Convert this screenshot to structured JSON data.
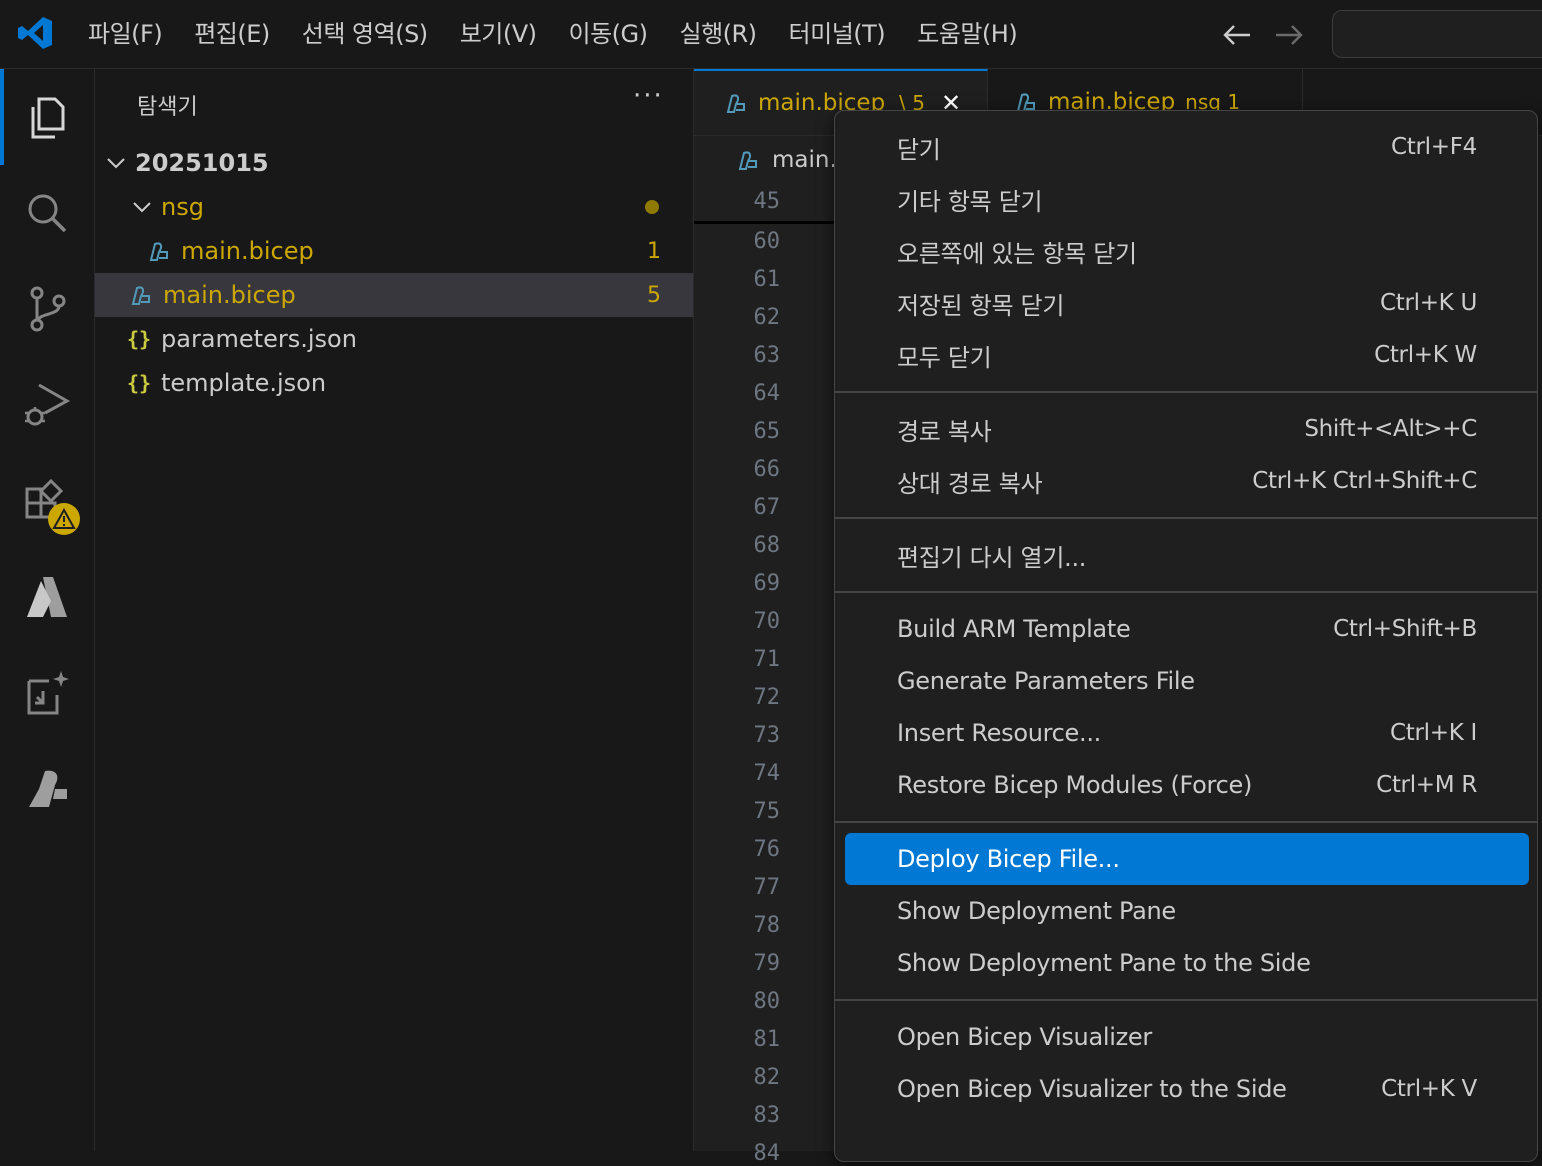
{
  "menubar": {
    "items": [
      "파일(F)",
      "편집(E)",
      "선택 영역(S)",
      "보기(V)",
      "이동(G)",
      "실행(R)",
      "터미널(T)",
      "도움말(H)"
    ]
  },
  "sidebar": {
    "title": "탐색기",
    "more": "···",
    "tree": {
      "root": "20251015",
      "folder": "nsg",
      "nsg_file": "main.bicep",
      "nsg_file_count": "1",
      "main_file": "main.bicep",
      "main_file_count": "5",
      "params_file": "parameters.json",
      "template_file": "template.json",
      "braces": "{}"
    }
  },
  "editor": {
    "tabs": [
      {
        "label": "main.bicep",
        "suffix": "\\ 5",
        "close": "✕"
      },
      {
        "label": "main.bicep",
        "suffix": "nsg 1"
      }
    ],
    "breadcrumb": "main.",
    "sticky_line": "45",
    "line_numbers": [
      "60",
      "61",
      "62",
      "63",
      "64",
      "65",
      "66",
      "67",
      "68",
      "69",
      "70",
      "71",
      "72",
      "73",
      "74",
      "75",
      "76",
      "77",
      "78",
      "79",
      "80",
      "81",
      "82",
      "83",
      "84"
    ]
  },
  "context_menu": {
    "groups": [
      [
        {
          "label": "닫기",
          "key": "Ctrl+F4"
        },
        {
          "label": "기타 항목 닫기",
          "key": ""
        },
        {
          "label": "오른쪽에 있는 항목 닫기",
          "key": ""
        },
        {
          "label": "저장된 항목 닫기",
          "key": "Ctrl+K U"
        },
        {
          "label": "모두 닫기",
          "key": "Ctrl+K W"
        }
      ],
      [
        {
          "label": "경로 복사",
          "key": "Shift+<Alt>+C"
        },
        {
          "label": "상대 경로 복사",
          "key": "Ctrl+K Ctrl+Shift+C"
        }
      ],
      [
        {
          "label": "편집기 다시 열기...",
          "key": ""
        }
      ],
      [
        {
          "label": "Build ARM Template",
          "key": "Ctrl+Shift+B"
        },
        {
          "label": "Generate Parameters File",
          "key": ""
        },
        {
          "label": "Insert Resource...",
          "key": "Ctrl+K I"
        },
        {
          "label": "Restore Bicep Modules (Force)",
          "key": "Ctrl+M R"
        }
      ],
      [
        {
          "label": "Deploy Bicep File...",
          "key": ""
        },
        {
          "label": "Show Deployment Pane",
          "key": ""
        },
        {
          "label": "Show Deployment Pane to the Side",
          "key": ""
        }
      ],
      [
        {
          "label": "Open Bicep Visualizer",
          "key": ""
        },
        {
          "label": "Open Bicep Visualizer to the Side",
          "key": "Ctrl+K V"
        }
      ]
    ],
    "highlighted": "Deploy Bicep File..."
  },
  "colors": {
    "accent": "#0078d4",
    "warning": "#cca700",
    "background": "#181818"
  }
}
